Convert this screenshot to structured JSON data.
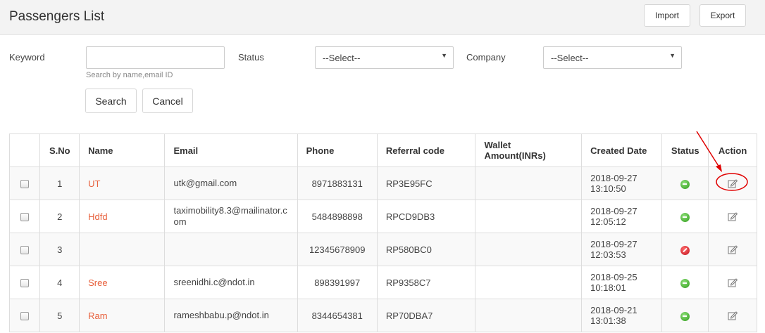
{
  "header": {
    "title": "Passengers List",
    "import_label": "Import",
    "export_label": "Export"
  },
  "filters": {
    "keyword_label": "Keyword",
    "keyword_value": "",
    "keyword_hint": "Search by name,email ID",
    "status_label": "Status",
    "status_selected": "--Select--",
    "company_label": "Company",
    "company_selected": "--Select--",
    "search_label": "Search",
    "cancel_label": "Cancel"
  },
  "table": {
    "headers": [
      "",
      "S.No",
      "Name",
      "Email",
      "Phone",
      "Referral code",
      "Wallet Amount(INRs)",
      "Created Date",
      "Status",
      "Action"
    ],
    "rows": [
      {
        "sno": "1",
        "name": "UT",
        "email": "utk@gmail.com",
        "phone": "8971883131",
        "referral": "RP3E95FC",
        "wallet": "",
        "date": "2018-09-27",
        "time": "13:10:50",
        "status": "active"
      },
      {
        "sno": "2",
        "name": "Hdfd",
        "email": "taximobility8.3@mailinator.com",
        "phone": "5484898898",
        "referral": "RPCD9DB3",
        "wallet": "",
        "date": "2018-09-27",
        "time": "12:05:12",
        "status": "active"
      },
      {
        "sno": "3",
        "name": "",
        "email": "",
        "phone": "12345678909",
        "referral": "RP580BC0",
        "wallet": "",
        "date": "2018-09-27",
        "time": "12:03:53",
        "status": "inactive"
      },
      {
        "sno": "4",
        "name": "Sree",
        "email": "sreenidhi.c@ndot.in",
        "phone": "898391997",
        "referral": "RP9358C7",
        "wallet": "",
        "date": "2018-09-25",
        "time": "10:18:01",
        "status": "active"
      },
      {
        "sno": "5",
        "name": "Ram",
        "email": "rameshbabu.p@ndot.in",
        "phone": "8344654381",
        "referral": "RP70DBA7",
        "wallet": "",
        "date": "2018-09-21",
        "time": "13:01:38",
        "status": "active"
      }
    ]
  },
  "icons": {
    "active_status": "active-status-icon",
    "inactive_status": "inactive-status-icon",
    "edit": "edit-icon"
  },
  "colors": {
    "name_link": "#e8613d",
    "active": "#2e9b1a",
    "inactive": "#c1121f",
    "annotation": "#e00000"
  }
}
